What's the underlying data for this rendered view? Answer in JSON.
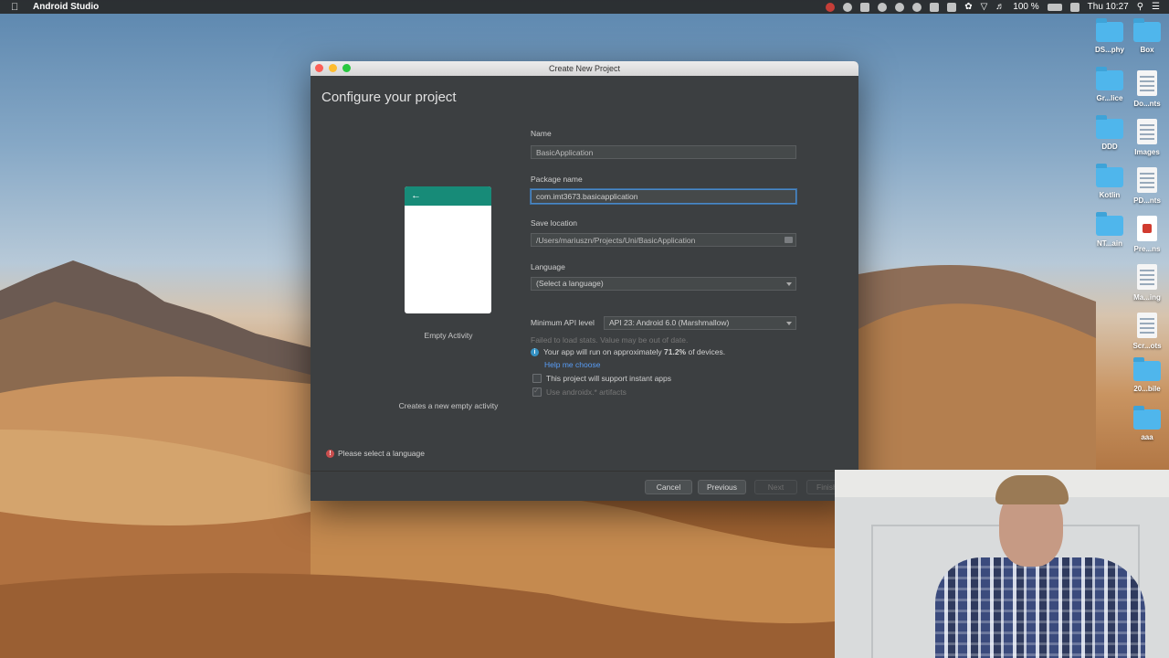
{
  "menubar": {
    "app_name": "Android Studio",
    "battery": "100 %",
    "clock": "Thu 10:27"
  },
  "desktop": {
    "icons": [
      {
        "label": "DS...phy",
        "kind": "folder"
      },
      {
        "label": "Box",
        "kind": "folder"
      },
      {
        "label": "Gr...lice",
        "kind": "folder"
      },
      {
        "label": "Do...nts",
        "kind": "doc"
      },
      {
        "label": "DDD",
        "kind": "folder"
      },
      {
        "label": "Images",
        "kind": "doc"
      },
      {
        "label": "Kotlin",
        "kind": "folder"
      },
      {
        "label": "PD...nts",
        "kind": "doc"
      },
      {
        "label": "NT...ain",
        "kind": "folder"
      },
      {
        "label": "Pre...ns",
        "kind": "pdf"
      },
      {
        "label": "Ma...ing",
        "kind": "doc"
      },
      {
        "label": "Scr...ots",
        "kind": "doc"
      },
      {
        "label": "20...bile",
        "kind": "folder"
      },
      {
        "label": "aaa",
        "kind": "folder"
      }
    ]
  },
  "dialog": {
    "window_title": "Create New Project",
    "heading": "Configure your project",
    "template_name": "Empty Activity",
    "template_description": "Creates a new empty activity",
    "name_label": "Name",
    "name_value": "BasicApplication",
    "package_label": "Package name",
    "package_value": "com.imt3673.basicapplication",
    "location_label": "Save location",
    "location_value": "/Users/mariuszn/Projects/Uni/BasicApplication",
    "language_label": "Language",
    "language_value": "(Select a language)",
    "min_api_label": "Minimum API level",
    "min_api_value": "API 23: Android 6.0 (Marshmallow)",
    "stats_warning": "Failed to load stats. Value may be out of date.",
    "info_prefix": "Your app will run on approximately ",
    "info_percent": "71.2%",
    "info_suffix": " of devices.",
    "help_link": "Help me choose",
    "instant_apps_label": "This project will support instant apps",
    "instant_apps_checked": false,
    "androidx_label": "Use androidx.* artifacts",
    "androidx_checked": true,
    "error_message": "Please select a language",
    "buttons": {
      "cancel": "Cancel",
      "previous": "Previous",
      "next": "Next",
      "finish": "Finish"
    }
  },
  "colors": {
    "toolbar_teal": "#178b78",
    "dialog_bg": "#3c3f41",
    "link_blue": "#589df6",
    "error_red": "#c94e4e"
  }
}
